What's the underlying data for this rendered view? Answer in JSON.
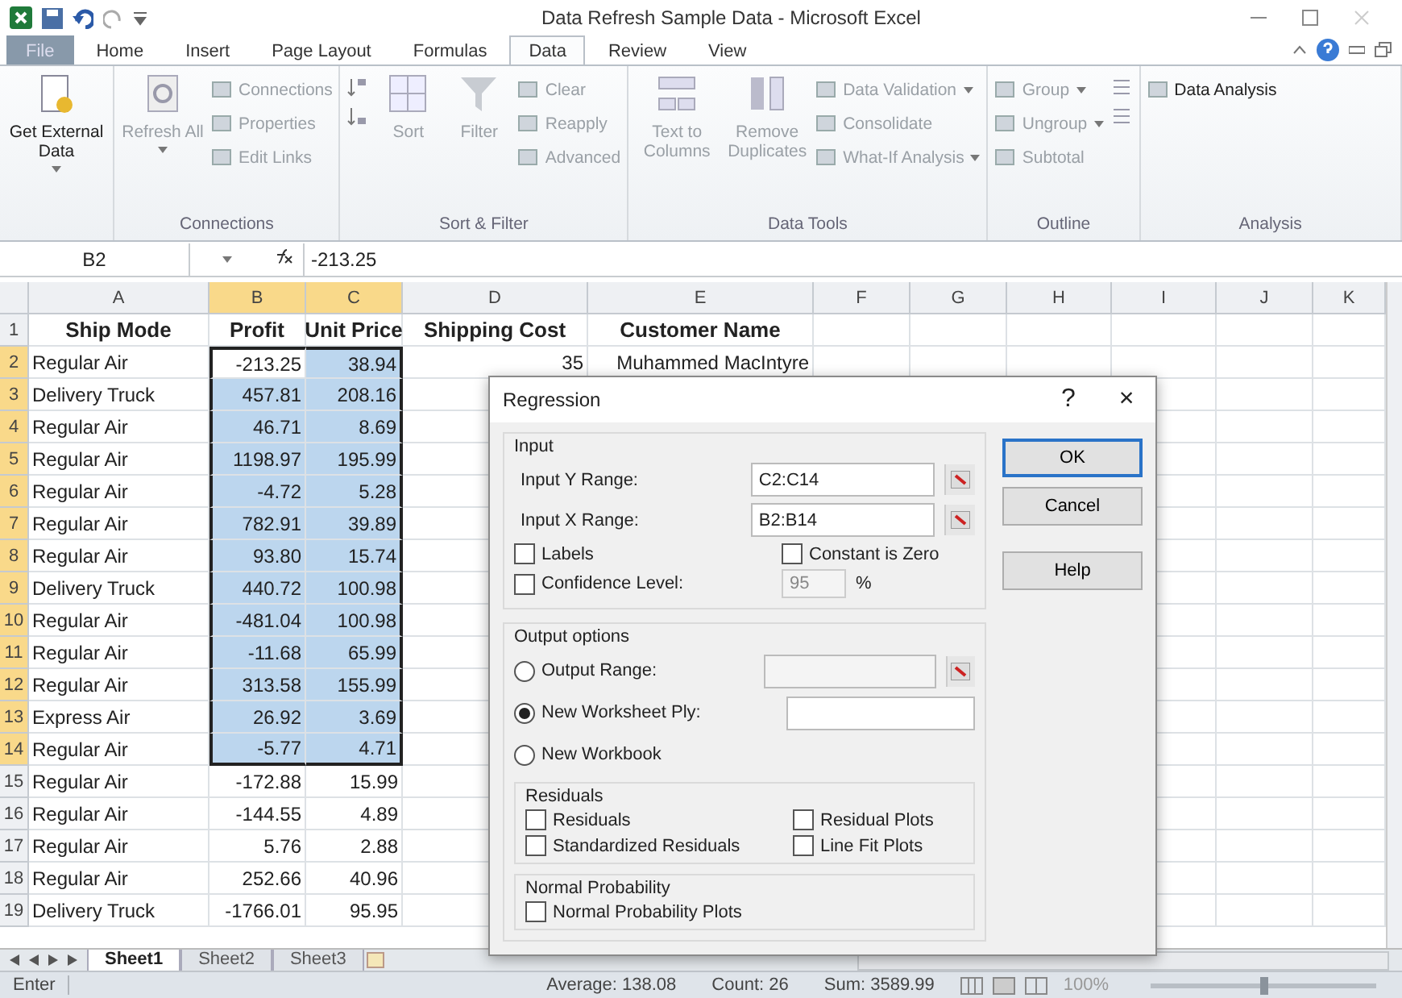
{
  "window": {
    "title": "Data Refresh Sample Data - Microsoft Excel"
  },
  "tabs": [
    {
      "label": "File",
      "kind": "file",
      "selected": false
    },
    {
      "label": "Home",
      "selected": false
    },
    {
      "label": "Insert",
      "selected": false
    },
    {
      "label": "Page Layout",
      "selected": false
    },
    {
      "label": "Formulas",
      "selected": false
    },
    {
      "label": "Data",
      "selected": true
    },
    {
      "label": "Review",
      "selected": false
    },
    {
      "label": "View",
      "selected": false
    }
  ],
  "ribbon": {
    "groups": [
      {
        "items": [
          {
            "kind": "large",
            "label": "Get External Data",
            "dropdown": true,
            "disabled": false
          }
        ]
      },
      {
        "label": "Connections",
        "items": [
          {
            "kind": "large",
            "label": "Refresh All",
            "dropdown": true,
            "disabled": true
          },
          {
            "kind": "small",
            "label": "Connections",
            "disabled": true
          },
          {
            "kind": "small",
            "label": "Properties",
            "disabled": true
          },
          {
            "kind": "small",
            "label": "Edit Links",
            "disabled": true
          }
        ]
      },
      {
        "label": "Sort & Filter",
        "items": [
          {
            "kind": "sort-icons"
          },
          {
            "kind": "large",
            "label": "Sort",
            "disabled": true
          },
          {
            "kind": "large",
            "label": "Filter",
            "disabled": true
          },
          {
            "kind": "small",
            "label": "Clear",
            "disabled": true
          },
          {
            "kind": "small",
            "label": "Reapply",
            "disabled": true
          },
          {
            "kind": "small",
            "label": "Advanced",
            "disabled": true
          }
        ]
      },
      {
        "label": "Data Tools",
        "items": [
          {
            "kind": "large",
            "label": "Text to Columns",
            "disabled": true
          },
          {
            "kind": "large",
            "label": "Remove Duplicates",
            "disabled": true
          },
          {
            "kind": "small",
            "label": "Data Validation",
            "dropdown": true,
            "disabled": true
          },
          {
            "kind": "small",
            "label": "Consolidate",
            "disabled": true
          },
          {
            "kind": "small",
            "label": "What-If Analysis",
            "dropdown": true,
            "disabled": true
          }
        ]
      },
      {
        "label": "Outline",
        "items": [
          {
            "kind": "small",
            "label": "Group",
            "dropdown": true,
            "disabled": true
          },
          {
            "kind": "small",
            "label": "Ungroup",
            "dropdown": true,
            "disabled": true
          },
          {
            "kind": "small",
            "label": "Subtotal",
            "disabled": true
          },
          {
            "kind": "detail-icons"
          }
        ]
      },
      {
        "label": "Analysis",
        "items": [
          {
            "kind": "small",
            "label": "Data Analysis",
            "disabled": false
          }
        ]
      }
    ]
  },
  "formula_bar": {
    "name_box": "B2",
    "formula": "-213.25"
  },
  "columns": [
    {
      "label": "A",
      "selected": false
    },
    {
      "label": "B",
      "selected": true
    },
    {
      "label": "C",
      "selected": true
    },
    {
      "label": "D",
      "selected": false
    },
    {
      "label": "E",
      "selected": false
    },
    {
      "label": "F",
      "selected": false
    },
    {
      "label": "G",
      "selected": false
    },
    {
      "label": "H",
      "selected": false
    },
    {
      "label": "I",
      "selected": false
    },
    {
      "label": "J",
      "selected": false
    },
    {
      "label": "K",
      "selected": false
    }
  ],
  "rows": [
    {
      "number": "1",
      "selected": false,
      "header": true,
      "cells": [
        "Ship Mode",
        "Profit",
        "Unit Price",
        "Shipping Cost",
        "Customer Name"
      ]
    },
    {
      "number": "2",
      "selected": true,
      "cells": [
        "Regular Air",
        "-213.25",
        "38.94",
        "35",
        "Muhammed MacIntyre"
      ]
    },
    {
      "number": "3",
      "selected": true,
      "cells": [
        "Delivery Truck",
        "457.81",
        "208.16"
      ]
    },
    {
      "number": "4",
      "selected": true,
      "cells": [
        "Regular Air",
        "46.71",
        "8.69"
      ]
    },
    {
      "number": "5",
      "selected": true,
      "cells": [
        "Regular Air",
        "1198.97",
        "195.99"
      ]
    },
    {
      "number": "6",
      "selected": true,
      "cells": [
        "Regular Air",
        "-4.72",
        "5.28"
      ]
    },
    {
      "number": "7",
      "selected": true,
      "cells": [
        "Regular Air",
        "782.91",
        "39.89"
      ]
    },
    {
      "number": "8",
      "selected": true,
      "cells": [
        "Regular Air",
        "93.80",
        "15.74"
      ]
    },
    {
      "number": "9",
      "selected": true,
      "cells": [
        "Delivery Truck",
        "440.72",
        "100.98"
      ]
    },
    {
      "number": "10",
      "selected": true,
      "cells": [
        "Regular Air",
        "-481.04",
        "100.98"
      ]
    },
    {
      "number": "11",
      "selected": true,
      "cells": [
        "Regular Air",
        "-11.68",
        "65.99"
      ]
    },
    {
      "number": "12",
      "selected": true,
      "cells": [
        "Regular Air",
        "313.58",
        "155.99"
      ]
    },
    {
      "number": "13",
      "selected": true,
      "cells": [
        "Express Air",
        "26.92",
        "3.69"
      ]
    },
    {
      "number": "14",
      "selected": true,
      "cells": [
        "Regular Air",
        "-5.77",
        "4.71"
      ]
    },
    {
      "number": "15",
      "selected": false,
      "cells": [
        "Regular Air",
        "-172.88",
        "15.99"
      ]
    },
    {
      "number": "16",
      "selected": false,
      "cells": [
        "Regular Air",
        "-144.55",
        "4.89"
      ]
    },
    {
      "number": "17",
      "selected": false,
      "cells": [
        "Regular Air",
        "5.76",
        "2.88"
      ]
    },
    {
      "number": "18",
      "selected": false,
      "cells": [
        "Regular Air",
        "252.66",
        "40.96"
      ]
    },
    {
      "number": "19",
      "selected": false,
      "cells": [
        "Delivery Truck",
        "-1766.01",
        "95.95"
      ]
    }
  ],
  "dialog": {
    "title": "Regression",
    "help": "?",
    "close": "×",
    "input": {
      "legend": "Input",
      "y_range": {
        "label": "Input Y Range:",
        "value": "C2:C14"
      },
      "x_range": {
        "label": "Input X Range:",
        "value": "B2:B14"
      },
      "options": [
        {
          "label": "Labels",
          "checked": false
        },
        {
          "label": "Constant is Zero",
          "checked": false
        },
        {
          "label": "Confidence Level:",
          "checked": false
        }
      ],
      "confidence": {
        "value": "95",
        "unit": "%",
        "disabled": true
      }
    },
    "output": {
      "legend": "Output options",
      "choices": [
        {
          "label": "Output Range:",
          "selected": false,
          "kind": "range"
        },
        {
          "label": "New Worksheet Ply:",
          "selected": true,
          "kind": "text"
        },
        {
          "label": "New Workbook",
          "selected": false
        }
      ],
      "residuals": {
        "legend": "Residuals",
        "options": [
          {
            "label": "Residuals",
            "checked": false
          },
          {
            "label": "Residual Plots",
            "checked": false
          },
          {
            "label": "Standardized Residuals",
            "checked": false
          },
          {
            "label": "Line Fit Plots",
            "checked": false
          }
        ]
      },
      "normal": {
        "legend": "Normal Probability",
        "options": [
          {
            "label": "Normal Probability Plots",
            "checked": false
          }
        ]
      }
    },
    "buttons": [
      {
        "label": "OK",
        "default": true
      },
      {
        "label": "Cancel",
        "default": false
      },
      {
        "label": "Help",
        "default": false
      }
    ]
  },
  "sheet_tabs": [
    {
      "label": "Sheet1",
      "selected": true
    },
    {
      "label": "Sheet2",
      "selected": false
    },
    {
      "label": "Sheet3",
      "selected": false
    }
  ],
  "status_bar": {
    "mode": "Enter",
    "stats": [
      "Average: 138.08",
      "Count: 26",
      "Sum: 3589.99"
    ],
    "zoom": {
      "label": "100%",
      "level": 0.5
    }
  }
}
